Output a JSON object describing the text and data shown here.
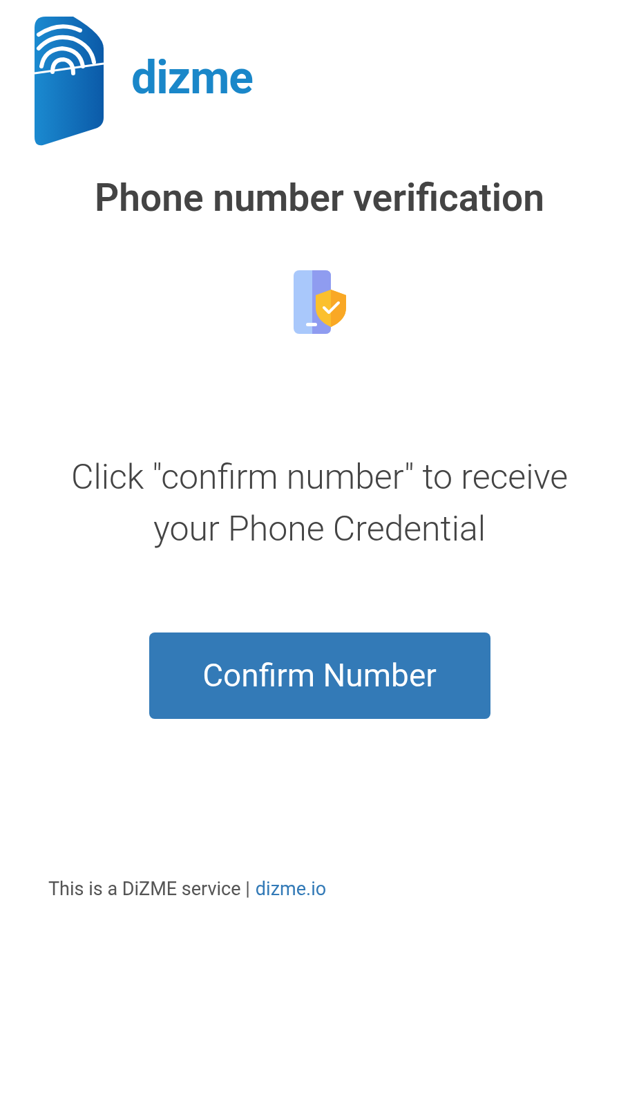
{
  "logo": {
    "wordmark": "dizme"
  },
  "title": "Phone number verification",
  "message": "Click \"confirm number\" to receive your Phone Credential",
  "button": {
    "label": "Confirm Number"
  },
  "footer": {
    "text": "This is a DiZME service |",
    "link": "dizme.io"
  }
}
